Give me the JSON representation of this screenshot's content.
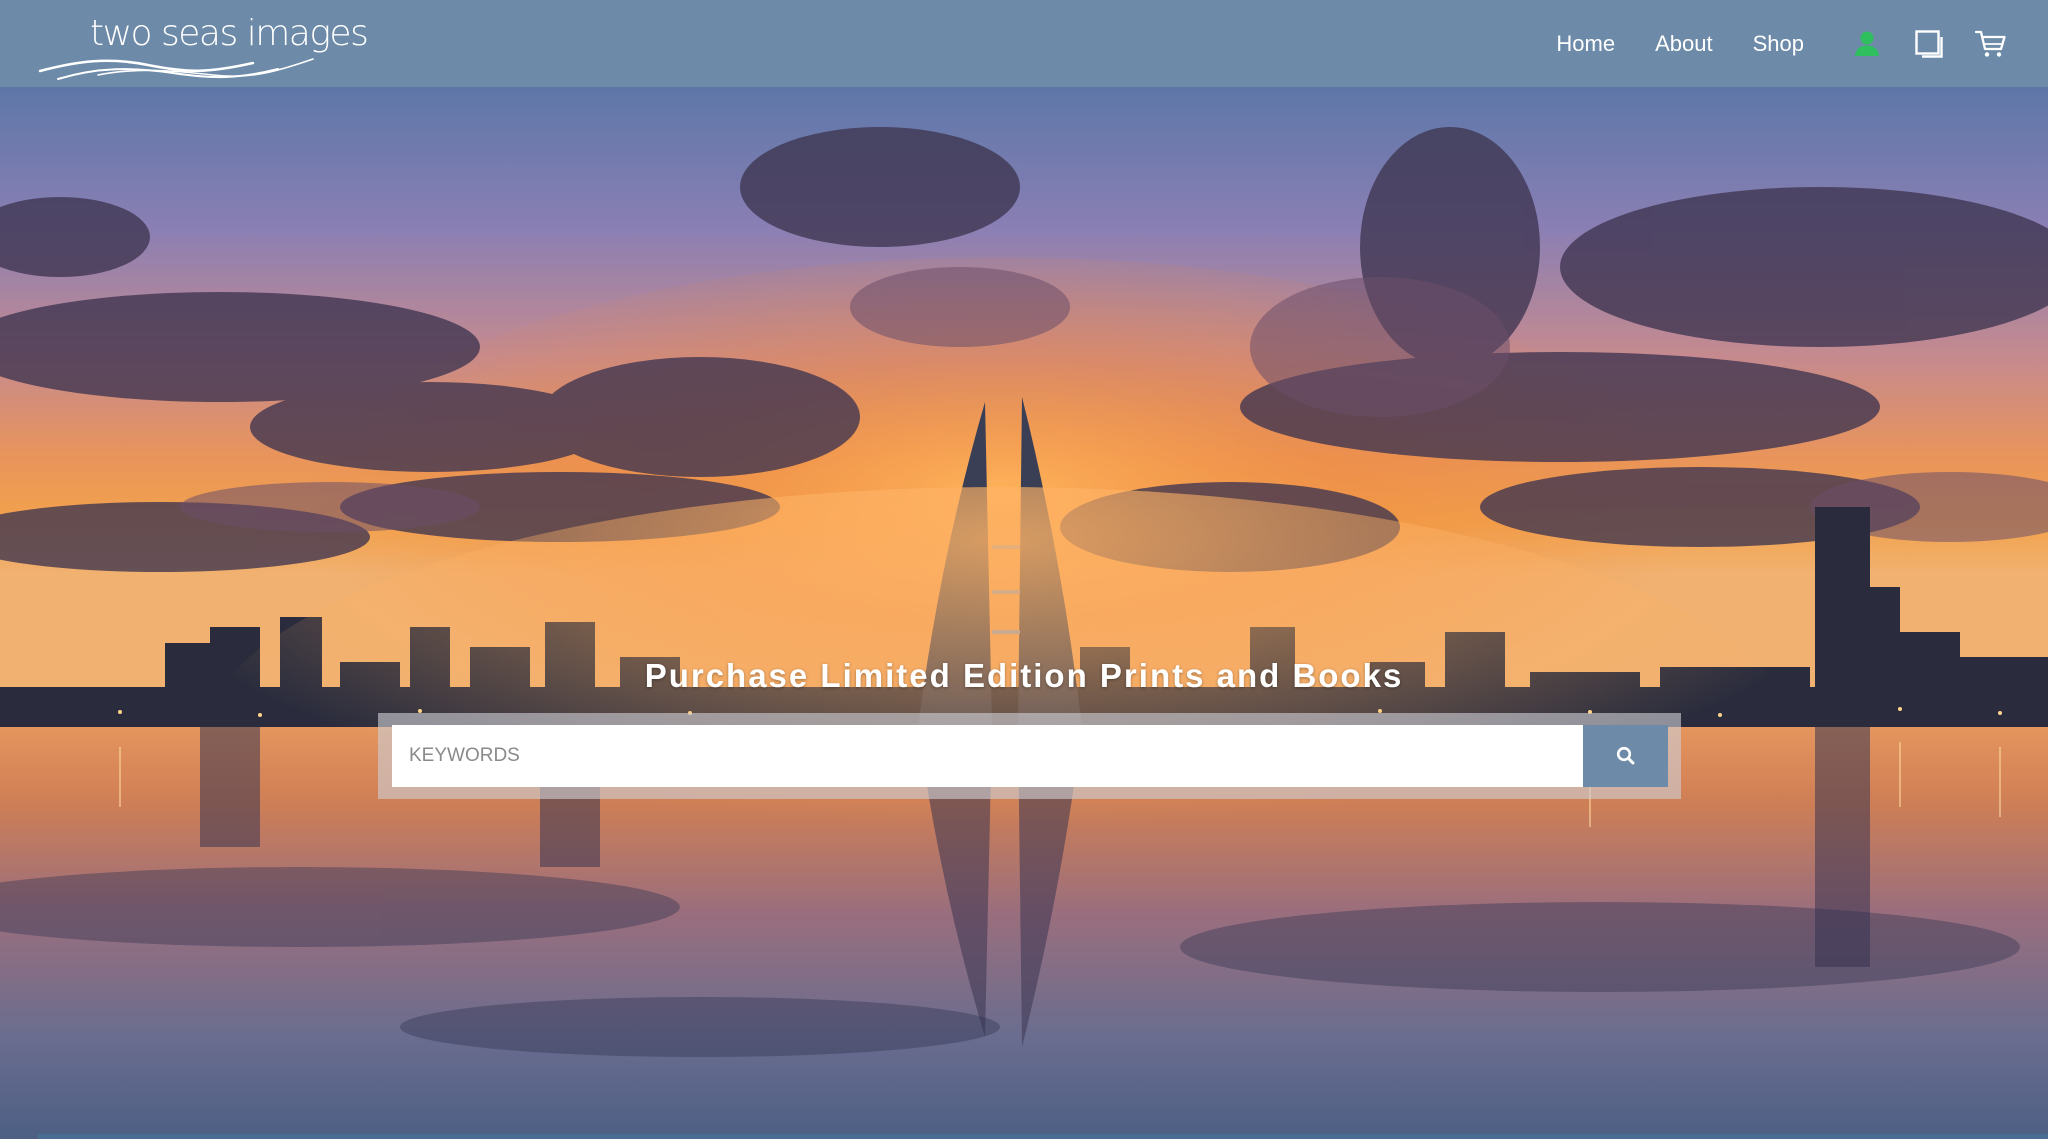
{
  "brand": {
    "name": "two seas images"
  },
  "nav": {
    "links": [
      "Home",
      "About",
      "Shop"
    ],
    "icons": [
      "account-icon",
      "gallery-icon",
      "cart-icon"
    ]
  },
  "hero": {
    "title": "Purchase Limited Edition Prints and Books"
  },
  "search": {
    "placeholder": "KEYWORDS",
    "value": "",
    "button_icon": "search-icon"
  },
  "colors": {
    "header": "#6d8ba8",
    "accent": "#6d8ba8",
    "account_icon": "#2fbf5f",
    "text": "#ffffff"
  }
}
